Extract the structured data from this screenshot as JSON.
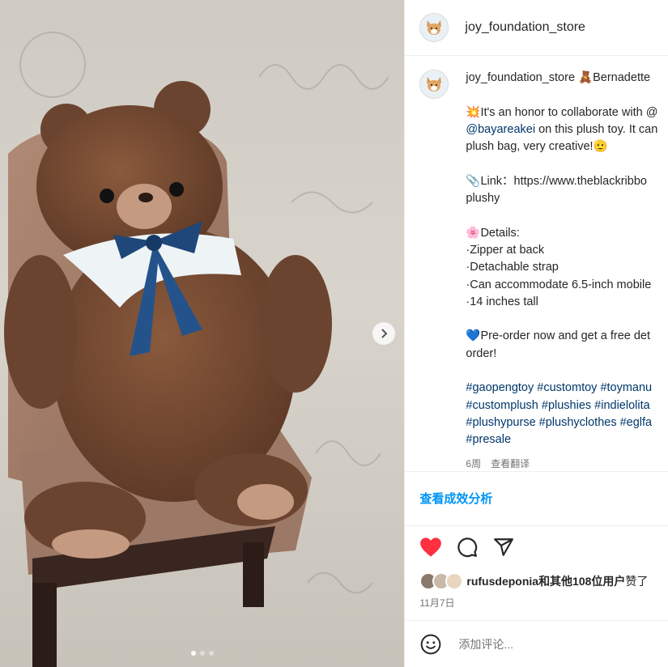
{
  "header": {
    "username": "joy_foundation_store"
  },
  "caption": {
    "username": "joy_foundation_store",
    "lines": [
      "🧸Bernadette",
      "💥It's an honor to collaborate with @",
      "",
      "plush bag, very creative!🫡",
      "",
      "📎Link：https://www.theblackribbo",
      "plushy",
      "",
      "🌸Details:",
      "·Zipper at back",
      "·Detachable strap",
      "·Can accommodate 6.5-inch mobile",
      "·14 inches tall",
      "",
      "💙Pre-order now and get a free det",
      "order!",
      ""
    ],
    "mention": "@bayareakei",
    "mention_rest": " on this plush toy. It can",
    "hashtag_lines": [
      "#gaopengtoy #customtoy #toymanu",
      "#customplush #plushies #indielolita",
      "#plushypurse #plushyclothes #eglfa",
      "#presale"
    ],
    "age": "6周",
    "translate": "查看翻译"
  },
  "insights": {
    "label": "查看成效分析"
  },
  "likes": {
    "user": "rufusdeponia",
    "rest_bold": "和其他108位用户",
    "suffix": "赞了"
  },
  "date": "11月7日",
  "comment": {
    "placeholder": "添加评论..."
  },
  "colors": {
    "like": "#ff3040",
    "link": "#00376b",
    "accent": "#0095f6"
  },
  "icons": [
    "heart-icon",
    "comment-icon",
    "share-icon",
    "emoji-icon",
    "chevron-right-icon"
  ]
}
